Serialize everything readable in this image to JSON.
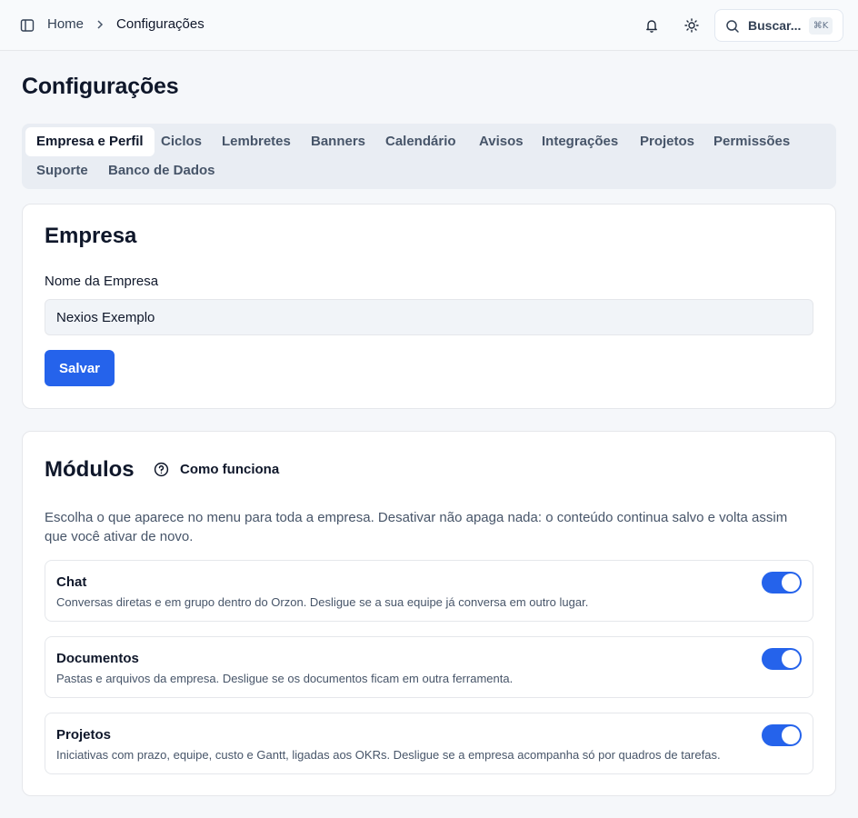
{
  "header": {
    "breadcrumb_home": "Home",
    "breadcrumb_current": "Configurações",
    "search_label": "Buscar...",
    "search_shortcut": "⌘K"
  },
  "page": {
    "title": "Configurações"
  },
  "tabs": [
    {
      "label": "Empresa e Perfil",
      "active": true
    },
    {
      "label": "Ciclos",
      "active": false
    },
    {
      "label": "Lembretes",
      "active": false
    },
    {
      "label": "Banners",
      "active": false
    },
    {
      "label": "Calendário",
      "active": false
    },
    {
      "label": "Avisos",
      "active": false
    },
    {
      "label": "Integrações",
      "active": false
    },
    {
      "label": "Projetos",
      "active": false
    },
    {
      "label": "Permissões",
      "active": false
    },
    {
      "label": "Suporte",
      "active": false
    },
    {
      "label": "Banco de Dados",
      "active": false
    }
  ],
  "company": {
    "title": "Empresa",
    "name_label": "Nome da Empresa",
    "name_value": "Nexios Exemplo",
    "save_label": "Salvar"
  },
  "modules": {
    "title": "Módulos",
    "help_link": "Como funciona",
    "description": "Escolha o que aparece no menu para toda a empresa. Desativar não apaga nada: o conteúdo continua salvo e volta assim que você ativar de novo.",
    "items": [
      {
        "name": "Chat",
        "description": "Conversas diretas e em grupo dentro do Orzon. Desligue se a sua equipe já conversa em outro lugar.",
        "enabled": true
      },
      {
        "name": "Documentos",
        "description": "Pastas e arquivos da empresa. Desligue se os documentos ficam em outra ferramenta.",
        "enabled": true
      },
      {
        "name": "Projetos",
        "description": "Iniciativas com prazo, equipe, custo e Gantt, ligadas aos OKRs. Desligue se a empresa acompanha só por quadros de tarefas.",
        "enabled": true
      }
    ]
  },
  "colors": {
    "accent": "#2563eb",
    "toggle_on": "#2563eb",
    "toggle_off": "#cbd5e1"
  },
  "icons": {
    "sidebar_toggle": "sidebar-icon",
    "breadcrumb_separator": "chevron-right-icon",
    "notifications": "bell-icon",
    "theme": "sun-icon",
    "search": "search-icon",
    "help": "help-circle-icon"
  }
}
